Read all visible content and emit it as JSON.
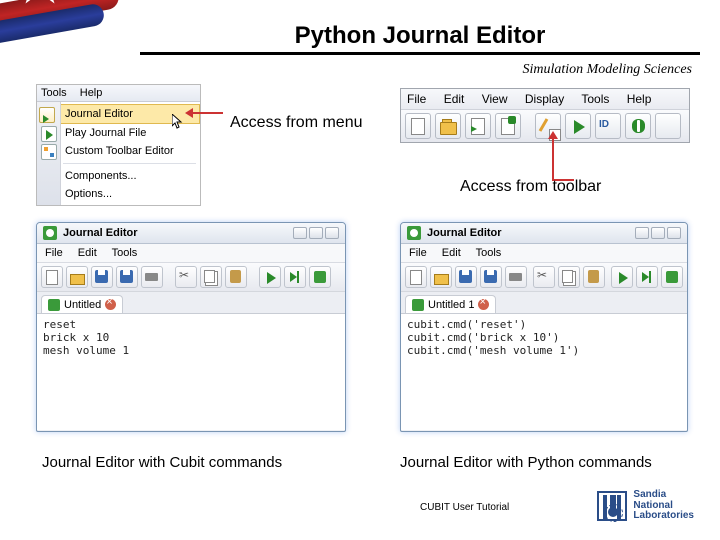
{
  "slide": {
    "title": "Python Journal Editor",
    "subtitle": "Simulation Modeling Sciences",
    "footer": "CUBIT User Tutorial",
    "sandia_line1": "Sandia",
    "sandia_line2": "National",
    "sandia_line3": "Laboratories"
  },
  "labels": {
    "access_menu": "Access from menu",
    "access_toolbar": "Access from toolbar",
    "caption_left": "Journal Editor with Cubit commands",
    "caption_right": "Journal Editor with Python commands"
  },
  "menu_panel": {
    "top_items": [
      "Tools",
      "Help"
    ],
    "rows": [
      {
        "label": "Journal Editor",
        "icon": "journal-editor-icon",
        "highlighted": true
      },
      {
        "label": "Play Journal File",
        "icon": "play-icon"
      },
      {
        "label": "Custom Toolbar Editor",
        "icon": "custom-toolbar-icon"
      }
    ],
    "lower_rows": [
      "Components...",
      "Options..."
    ]
  },
  "app_bar": {
    "menus": [
      "File",
      "Edit",
      "View",
      "Display",
      "Tools",
      "Help"
    ]
  },
  "je_window": {
    "title": "Journal Editor",
    "menus": [
      "File",
      "Edit",
      "Tools"
    ],
    "tab_left": "Untitled",
    "tab_right": "Untitled 1"
  },
  "editor_left_lines": "reset\nbrick x 10\nmesh volume 1",
  "editor_right_lines": "cubit.cmd('reset')\ncubit.cmd('brick x 10')\ncubit.cmd('mesh volume 1')"
}
